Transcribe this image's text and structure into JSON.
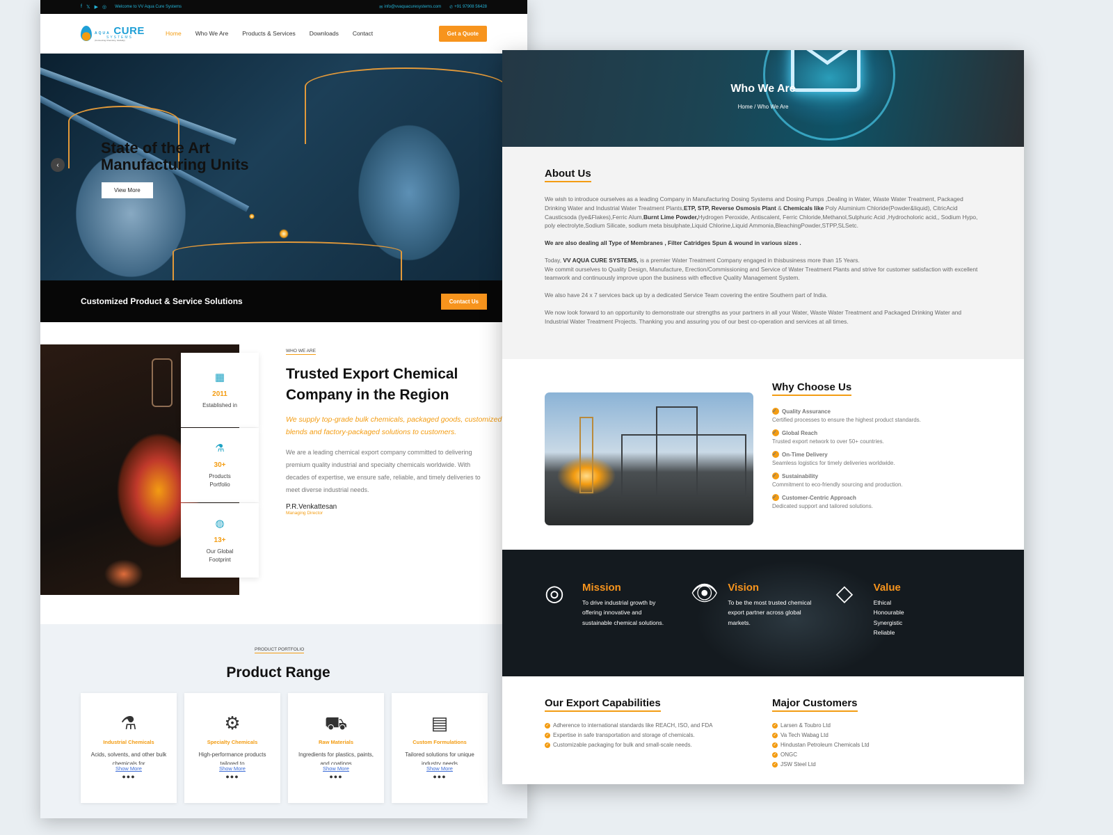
{
  "left": {
    "topbar": {
      "social_icons": [
        "facebook-icon",
        "x-icon",
        "youtube-icon",
        "instagram-icon"
      ],
      "welcome": "Welcome to VV Aqua Cure Systems",
      "email": "info@vvaquacuresystems.com",
      "phone": "+91 97908 56428"
    },
    "logo": {
      "word1": "AQUA",
      "word2": "CURE",
      "sub": "SYSTEMS",
      "tagline": "(Connecting Chemistry, Globally)"
    },
    "nav": {
      "items": [
        "Home",
        "Who We Are",
        "Products & Services",
        "Downloads",
        "Contact"
      ],
      "active": "Home",
      "quote_button": "Get a Quote"
    },
    "hero": {
      "heading": "State of the Art Manufacturing Units",
      "button": "View More"
    },
    "cta": {
      "text": "Customized Product & Service Solutions",
      "button": "Contact Us"
    },
    "who": {
      "eyebrow": "WHO WE ARE",
      "title": "Trusted Export Chemical Company in the Region",
      "lead": "We supply top-grade bulk chemicals, packaged goods, customized blends and factory-packaged solutions to customers.",
      "body": [
        "We are a leading chemical export company committed to delivering",
        "premium quality industrial and specialty chemicals worldwide. With",
        "decades of expertise, we ensure safe, reliable, and timely deliveries to",
        "meet diverse industrial needs."
      ],
      "signature": "P.R.Venkattesan",
      "signature_title": "Managing Director",
      "stats": [
        {
          "value": "2011",
          "label": "Established in",
          "icon": "building-icon"
        },
        {
          "value": "30+",
          "label": "Products Portfolio",
          "icon": "flask-icon"
        },
        {
          "value": "13+",
          "label": "Our Global Footprint",
          "icon": "globe-icon"
        }
      ]
    },
    "products": {
      "eyebrow": "PRODUCT PORTFOLIO",
      "title": "Product Range",
      "cards": [
        {
          "title": "Industrial Chemicals",
          "desc": "Acids, solvents, and other bulk chemicals for",
          "link": "Show More",
          "icon": "chemistry-icon"
        },
        {
          "title": "Specialty Chemicals",
          "desc": "High-performance products tailored to",
          "link": "Show More",
          "icon": "lab-icon"
        },
        {
          "title": "Raw Materials",
          "desc": "Ingredients for plastics, paints, and coatings",
          "link": "Show More",
          "icon": "truck-icon"
        },
        {
          "title": "Custom Formulations",
          "desc": "Tailored solutions for unique industry needs",
          "link": "Show More",
          "icon": "document-icon"
        }
      ]
    }
  },
  "right": {
    "banner": {
      "title": "Who We Are",
      "crumb_home": "Home",
      "crumb_sep": "/",
      "crumb_current": "Who We Are"
    },
    "about": {
      "title": "About Us",
      "p1_a": "We wish to introduce ourselves as a leading Company in Manufacturing Dosing Systems  and Dosing Pumps ,Dealing in Water, Waste Water Treatment, Packaged Drinking Water and Industrial Water Treatment Plants,",
      "p1_b": "ETP, STP, Reverse Osmosis Plant",
      "p1_c": " & ",
      "p1_d": "Chemicals like",
      "p1_e": " Poly Aluminium Chloride(Powder&liquid), CitricAcid Causticsoda (lye&Flakes),Ferric Alum,",
      "p1_f": "Burnt Lime Powder,",
      "p1_g": "Hydrogen Peroxide, Antiscalent, Ferric Chloride,Methanol,Sulphuric Acid ,Hydrocholoric acid,, Sodium Hypo, poly electrolyte,Sodium Silicate, sodium meta bisulphate,Liquid Chlorine,Liquid Ammonia,BleachingPowder,STPP,SLSetc.",
      "p2": "We are also dealing all  Type of Membranes , Filter Catridges  Spun & wound  in various sizes .",
      "p3_a": "Today, ",
      "p3_b": "VV AQUA CURE SYSTEMS,",
      "p3_c": " is a premier Water Treatment Company engaged in thisbusiness more than 15 Years.",
      "p3_d": "We commit ourselves to Quality Design, Manufacture, Erection/Commissioning and Service of Water Treatment Plants and strive for customer satisfaction with excellent teamwork and continuously improve upon the business with effective Quality Management System.",
      "p4": "We also have 24 x 7 services back up by a dedicated Service Team covering the entire Southern part of India.",
      "p5": "We now look forward to an opportunity to demonstrate our strengths as your partners in all your Water, Waste Water Treatment and Packaged Drinking Water and Industrial Water Treatment Projects. Thanking you and assuring you of our best co-operation and services at all times."
    },
    "why": {
      "title": "Why Choose Us",
      "items": [
        {
          "title": "Quality Assurance",
          "desc": "Certified processes to ensure the highest product standards."
        },
        {
          "title": "Global Reach",
          "desc": "Trusted export network to over 50+  countries."
        },
        {
          "title": "On-Time Delivery",
          "desc": "Seamless logistics for timely deliveries worldwide."
        },
        {
          "title": "Sustainability",
          "desc": "Commitment to eco-friendly sourcing and production."
        },
        {
          "title": "Customer-Centric Approach",
          "desc": "Dedicated support and tailored solutions."
        }
      ]
    },
    "mvv": [
      {
        "title": "Mission",
        "text": "To drive industrial growth by offering innovative and sustainable chemical solutions.",
        "icon": "target-icon"
      },
      {
        "title": "Vision",
        "text": "To be the most trusted chemical export partner across global markets.",
        "icon": "eye-icon"
      },
      {
        "title": "Value",
        "lines": [
          "Ethical",
          "Honourable",
          "Synergistic",
          "Reliable"
        ],
        "icon": "diamond-hand-icon"
      }
    ],
    "export": {
      "title": "Our Export Capabilities",
      "items": [
        "Adherence to international standards like REACH, ISO, and FDA",
        "Expertise in safe transportation and storage of chemicals.",
        "Customizable packaging for bulk and small-scale needs."
      ]
    },
    "customers": {
      "title": "Major Customers",
      "items": [
        "Larsen & Toubro Ltd",
        "Va Tech Wabag Ltd",
        "Hindustan Petroleum Chemicals Ltd",
        "ONGC",
        "JSW Steel Ltd"
      ]
    }
  }
}
